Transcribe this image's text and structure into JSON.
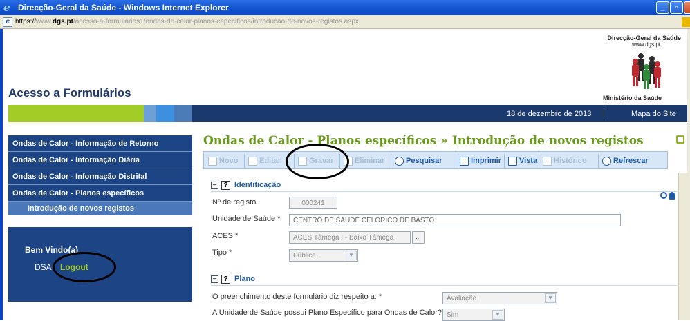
{
  "window": {
    "title": "Direcção-Geral da Saúde - Windows Internet Explorer",
    "buttons": {
      "minimize": "_",
      "maximize": "▫",
      "close": "X"
    }
  },
  "address": {
    "scheme": "https://",
    "prefix": "www.",
    "domain": "dgs.pt",
    "path": "/acesso-a-formularios1/ondas-de-calor-planos-especificos/introducao-de-novos-registos.aspx"
  },
  "header": {
    "site_title": "Acesso a Formulários",
    "org_name": "Direcção-Geral da Saúde",
    "org_url": "www.dgs.pt",
    "ministry": "Ministério da Saúde"
  },
  "topbar": {
    "date": "18 de dezembro de 2013",
    "separator": "|",
    "sitemap": "Mapa do Site"
  },
  "menu": {
    "items": [
      {
        "label": "Ondas de Calor - Informação de Retorno"
      },
      {
        "label": "Ondas de Calor - Informação Diária"
      },
      {
        "label": "Ondas de Calor - Informação Distrital"
      },
      {
        "label": "Ondas de Calor - Planos específicos"
      }
    ],
    "sub_item": "Introdução de novos registos"
  },
  "welcome": {
    "greeting": "Bem Vindo(a)",
    "user": "DSA",
    "logout": "Logout"
  },
  "content": {
    "heading": "Ondas de Calor - Planos específicos » Introdução de novos registos",
    "toolbar": {
      "novo": "Novo",
      "editar": "Editar",
      "gravar": "Gravar",
      "eliminar": "Eliminar",
      "pesquisar": "Pesquisar",
      "imprimir": "Imprimir",
      "vista": "Vista",
      "historico": "Histórico",
      "refrescar": "Refrescar"
    },
    "identificacao": {
      "title": "Identificação",
      "registo_label": "Nº de registo",
      "registo_value": "000241",
      "unidade_label": "Unidade de Saúde *",
      "unidade_value": "CENTRO DE SAUDE CELORICO DE BASTO",
      "aces_label": "ACES *",
      "aces_value": "ACES Tâmega I - Baixo Tâmega",
      "aces_button": "...",
      "tipo_label": "Tipo *",
      "tipo_value": "Pública"
    },
    "plano": {
      "title": "Plano",
      "q1_label": "O preenchimento deste formulário diz respeito a: *",
      "q1_value": "Avaliação",
      "q2_label": "A Unidade de Saúde possui Plano Específico para Ondas de Calor? *",
      "q2_value": "Sim"
    }
  },
  "colors": {
    "titlebar_blue": "#1656d0",
    "navy": "#1a3a6e",
    "menu_blue": "#1d4586",
    "accent_green": "#a3cc26",
    "heading_green": "#6a9a1c",
    "link_blue": "#1f5aa8"
  }
}
